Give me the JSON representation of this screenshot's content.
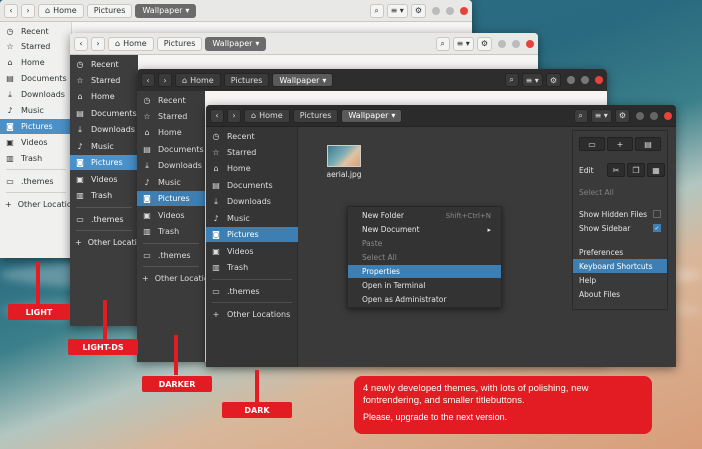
{
  "windows": {
    "light": {
      "breadcrumbs": [
        "Home",
        "Pictures",
        "Wallpaper"
      ],
      "sidebar": [
        "Recent",
        "Starred",
        "Home",
        "Documents",
        "Downloads",
        "Music",
        "Pictures",
        "Videos",
        "Trash",
        ".themes",
        "Other Locations"
      ]
    },
    "lightds": {
      "breadcrumbs": [
        "Home",
        "Pictures",
        "Wallpaper"
      ],
      "sidebar": [
        "Recent",
        "Starred",
        "Home",
        "Documents",
        "Downloads",
        "Music",
        "Pictures",
        "Videos",
        "Trash",
        ".themes",
        "Other Locations"
      ]
    },
    "darker": {
      "breadcrumbs": [
        "Home",
        "Pictures",
        "Wallpaper"
      ],
      "sidebar": [
        "Recent",
        "Starred",
        "Home",
        "Documents",
        "Downloads",
        "Music",
        "Pictures",
        "Videos",
        "Trash",
        ".themes",
        "Other Locations"
      ]
    },
    "dark": {
      "breadcrumbs": [
        "Home",
        "Pictures",
        "Wallpaper"
      ],
      "sidebar": [
        "Recent",
        "Starred",
        "Home",
        "Documents",
        "Downloads",
        "Music",
        "Pictures",
        "Videos",
        "Trash",
        ".themes",
        "Other Locations"
      ],
      "file_name": "aerial.jpg"
    }
  },
  "context_menu": {
    "items": [
      "New Folder",
      "New Document",
      "Paste",
      "Select All",
      "Properties",
      "Open in Terminal",
      "Open as Administrator"
    ],
    "new_folder_accel": "Shift+Ctrl+N"
  },
  "popover": {
    "edit": "Edit",
    "select_all": "Select All",
    "show_hidden": "Show Hidden Files",
    "show_sidebar": "Show Sidebar",
    "preferences": "Preferences",
    "shortcuts": "Keyboard Shortcuts",
    "help": "Help",
    "about": "About Files"
  },
  "labels": {
    "light": "LIGHT",
    "lightds": "LIGHT-DS",
    "darker": "DARKER",
    "dark": "DARK"
  },
  "note": {
    "line1": "4 newly developed themes, with lots of polishing, new fontrendering, and smaller titlebuttons.",
    "line2": "Please, upgrade to the next version."
  },
  "colors": {
    "accent": "#3d7fb3",
    "label_red": "#e31b23",
    "close_button": "#e8433b"
  }
}
